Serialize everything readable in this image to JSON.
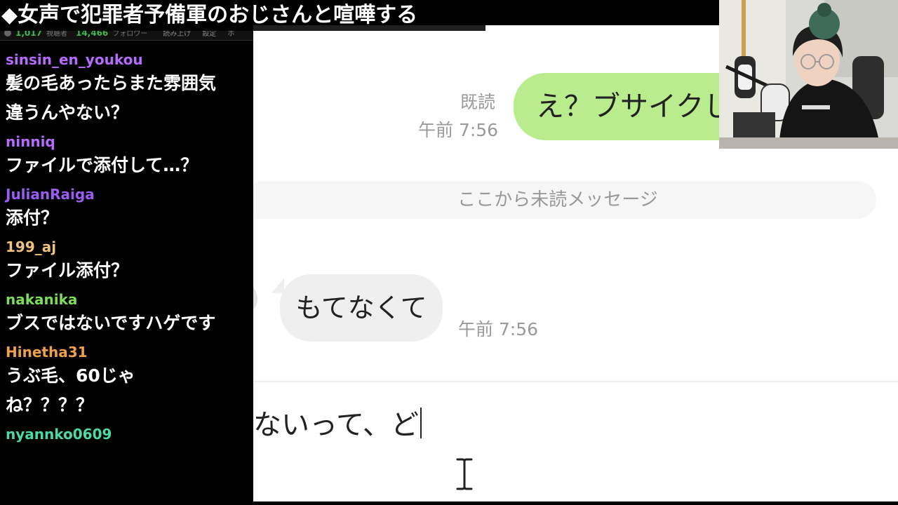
{
  "title_banner": "◆女声で犯罪者予備軍のおじさんと喧嘩する",
  "stats": {
    "viewers": "1,017",
    "viewers_label": "視聴者",
    "followers": "14,466",
    "followers_label": "フォロワー",
    "controls": [
      "読み上げ",
      "設定",
      "ホ"
    ]
  },
  "chat": {
    "messages": [
      {
        "user": "sinsin_en_youkou",
        "color": "#b56bff",
        "text": "髪の毛あったらまた雰囲気\n違うんやない？"
      },
      {
        "user": "ninniq",
        "color": "#b56bff",
        "text": "ファイルで添付して…？"
      },
      {
        "user": "JulianRaiga",
        "color": "#9b5cf5",
        "text": "添付？"
      },
      {
        "user": "199_aj",
        "color": "#f1c27d",
        "text": "ファイル添付？"
      },
      {
        "user": "nakanika",
        "color": "#7cdc5c",
        "text": "ブスではないですハゲです"
      },
      {
        "user": "Hinetha31",
        "color": "#f0a04b",
        "text": "うぶ毛、60じゃ\nね？？？？"
      },
      {
        "user": "nyannko0609",
        "color": "#4cd9a6",
        "text": ""
      }
    ]
  },
  "conversation": {
    "read_label": "既読",
    "sent_time": "午前 7:56",
    "sent_message": "え？ブサイクじゃ",
    "unread_divider": "ここから未読メッセージ",
    "received_message": "もてなくて",
    "received_time": "午前 7:56",
    "input_text": "ないって、ど"
  },
  "colors": {
    "sent_bubble": "#b9ec8d",
    "received_bubble": "#efefef",
    "stat_number": "#3fb950"
  }
}
